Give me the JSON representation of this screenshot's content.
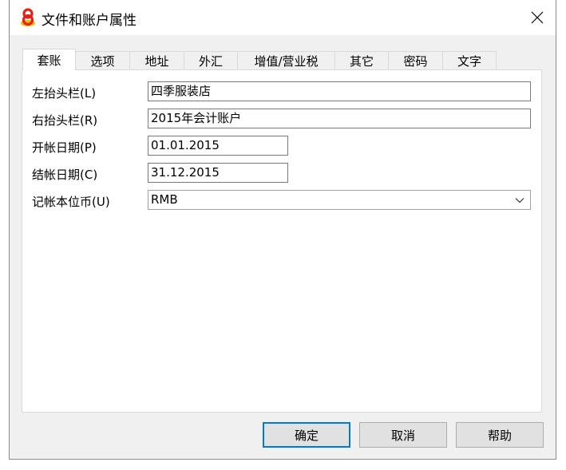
{
  "window": {
    "title": "文件和账户属性"
  },
  "tabs": [
    {
      "label": "套账",
      "active": true
    },
    {
      "label": "选项"
    },
    {
      "label": "地址"
    },
    {
      "label": "外汇"
    },
    {
      "label": "增值/营业税"
    },
    {
      "label": "其它"
    },
    {
      "label": "密码"
    },
    {
      "label": "文字"
    }
  ],
  "form": {
    "left_header_label": "左抬头栏(L)",
    "left_header_value": "四季服装店",
    "right_header_label": "右抬头栏(R)",
    "right_header_value": "2015年会计账户",
    "open_date_label": "开帐日期(P)",
    "open_date_value": "01.01.2015",
    "close_date_label": "结帐日期(C)",
    "close_date_value": "31.12.2015",
    "currency_label": "记帐本位币(U)",
    "currency_value": "RMB"
  },
  "buttons": {
    "ok": "确定",
    "cancel": "取消",
    "help": "帮助"
  },
  "colors": {
    "accent": "#0078d7",
    "logo_red": "#e2231a",
    "logo_yellow": "#f5b800"
  }
}
